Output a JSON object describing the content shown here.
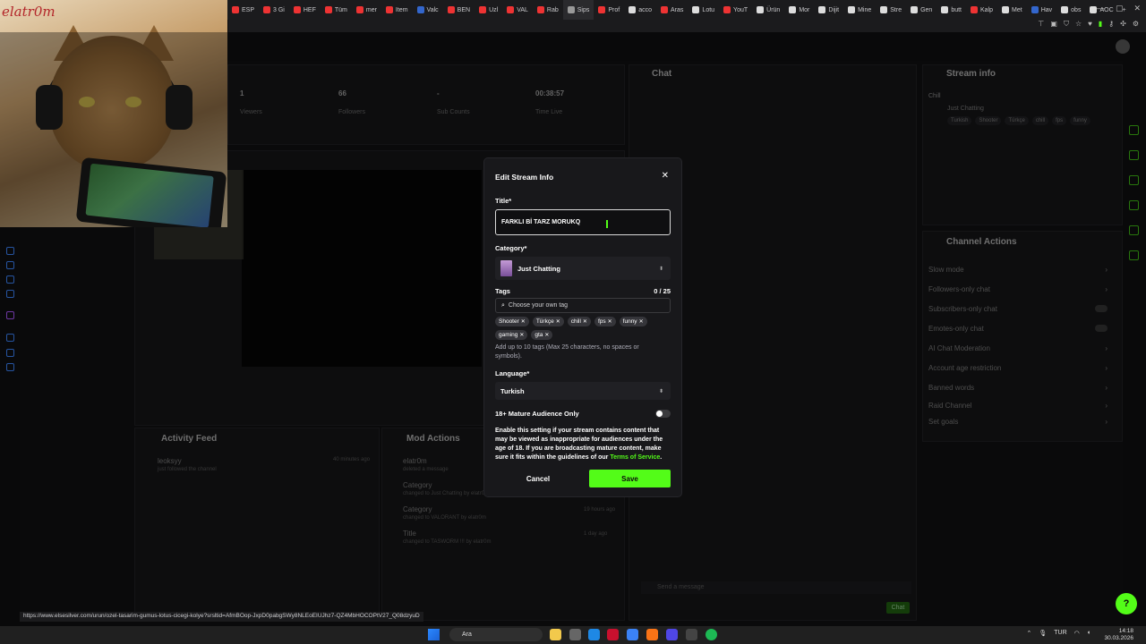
{
  "browser": {
    "tabs": [
      "ESP",
      "3 Gi",
      "HEF",
      "Tüm",
      "mer",
      "Item",
      "Valc",
      "BEN",
      "Uzl",
      "VAL",
      "Rab",
      "Sips",
      "Prof",
      "acco",
      "Aras",
      "Lotu",
      "YouT",
      "Ürün",
      "Mor",
      "Dijit",
      "Mine",
      "Stre",
      "Gen",
      "butt",
      "Kalp",
      "Met",
      "Hav",
      "obs",
      "AOC"
    ],
    "new_tab": "+",
    "active_tab_index": 11
  },
  "webcam": {
    "signature": "elatr0m"
  },
  "dashboard": {
    "stats": [
      {
        "value": "1",
        "label": "Viewers"
      },
      {
        "value": "66",
        "label": "Followers"
      },
      {
        "value": "-",
        "label": "Sub Counts"
      },
      {
        "value": "00:38:57",
        "label": "Time Live"
      }
    ],
    "chat_title": "Chat",
    "stream_info_title": "Stream info",
    "stream_info": {
      "title": "Chill",
      "category": "Just Chatting",
      "tags": [
        "Turkish",
        "Shooter",
        "Türkçe",
        "chill",
        "fps",
        "funny"
      ]
    },
    "channel_actions_title": "Channel Actions",
    "channel_actions": [
      {
        "label": "Slow mode"
      },
      {
        "label": "Followers-only chat"
      },
      {
        "label": "Subscribers-only chat"
      },
      {
        "label": "Emotes-only chat"
      },
      {
        "label": "AI Chat Moderation"
      },
      {
        "label": "Account age restriction"
      },
      {
        "label": "Banned words"
      },
      {
        "label": "Raid Channel"
      },
      {
        "label": "Set goals"
      }
    ],
    "activity_feed_title": "Activity Feed",
    "activity_feed": [
      {
        "user": "leoksyy",
        "text": "just followed the channel",
        "time": "40 minutes ago"
      }
    ],
    "mod_actions_title": "Mod Actions",
    "mod_actions": [
      {
        "title": "elatr0m",
        "text": "deleted a message"
      },
      {
        "title": "Category",
        "text": "changed to Just Chatting by elatr0m"
      },
      {
        "title": "Category",
        "text": "changed to VALORANT by elatr0m",
        "time": "19 hours ago"
      },
      {
        "title": "Title",
        "text": "changed to TASWORM !!! by elatr0m",
        "time": "1 day ago"
      }
    ],
    "chat_placeholder": "Send a message",
    "chat_button": "Chat"
  },
  "modal": {
    "heading": "Edit Stream Info",
    "title_label": "Title*",
    "title_value": "FARKLI Bİ TARZ MORUKQ",
    "category_label": "Category*",
    "category_value": "Just Chatting",
    "tags_label": "Tags",
    "tags_count": "0 / 25",
    "tag_placeholder": "Choose your own tag",
    "tags": [
      "Shooter",
      "Türkçe",
      "chill",
      "fps",
      "funny",
      "gaming",
      "gta"
    ],
    "tags_help": "Add up to 10 tags (Max 25 characters, no spaces or symbols).",
    "language_label": "Language*",
    "language_value": "Turkish",
    "mature_label": "18+ Mature Audience Only",
    "mature_on": false,
    "mature_desc": "Enable this setting if your stream contains content that may be viewed as inappropriate for audiences under the age of 18. If you are broadcasting mature content, make sure it fits within the guidelines of our",
    "tos_link": "Terms of Service",
    "tos_suffix": ".",
    "cancel_label": "Cancel",
    "save_label": "Save"
  },
  "status_link": "https://www.elsesilver.com/urun/ozel-tasarim-gumus-lotus-cicegi-kolye?srsltid=AfmBOop-JxpD0pabgSWy8NLEoEIUJhz7-QZ4MbHOCOPtV27_Q08dzyuD",
  "taskbar": {
    "search_label": "Ara",
    "language": "TUR",
    "time": "14:18",
    "date": "30.03.2026"
  },
  "colors": {
    "accent": "#53fc18",
    "modal_bg": "#18181b",
    "page_bg": "#0b0b0c"
  }
}
